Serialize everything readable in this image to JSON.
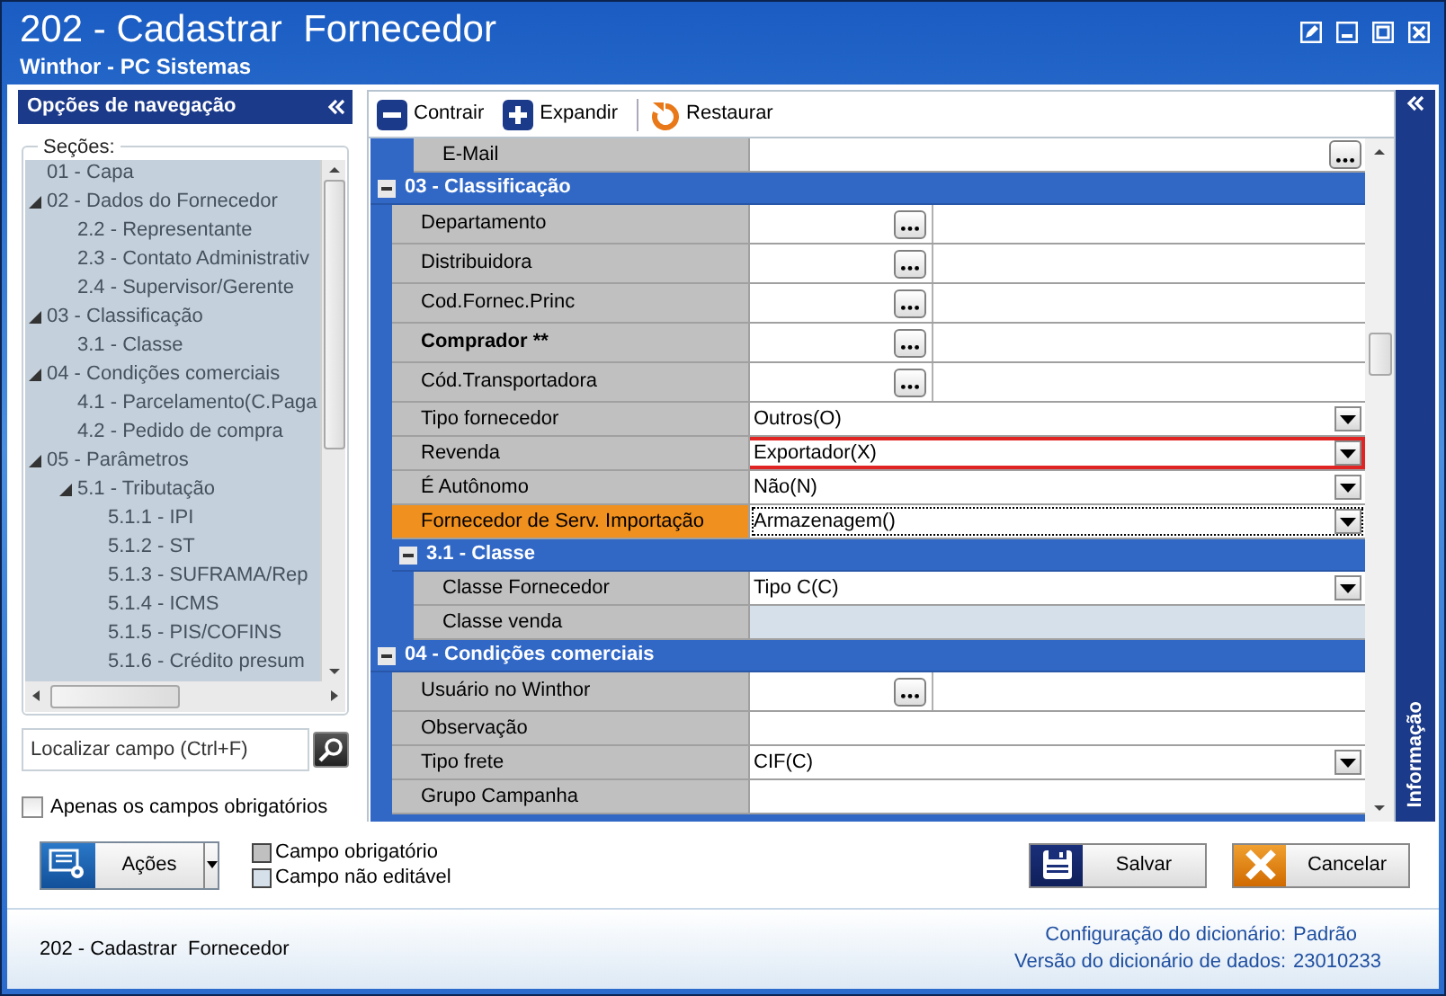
{
  "window": {
    "title": "202 - Cadastrar  Fornecedor",
    "subtitle": "Winthor - PC Sistemas"
  },
  "navigation": {
    "title": "Opções de navegação",
    "sections_label": "Seções:",
    "tree": [
      {
        "label": "01 - Capa"
      },
      {
        "label": "02 - Dados do Fornecedor",
        "expanded": true,
        "children": [
          {
            "label": "2.2 - Representante"
          },
          {
            "label": "2.3 - Contato Administrativ"
          },
          {
            "label": "2.4 - Supervisor/Gerente"
          }
        ]
      },
      {
        "label": "03 - Classificação",
        "expanded": true,
        "children": [
          {
            "label": "3.1 - Classe"
          }
        ]
      },
      {
        "label": "04 - Condições comerciais",
        "expanded": true,
        "children": [
          {
            "label": "4.1 - Parcelamento(C.Paga"
          },
          {
            "label": "4.2 - Pedido de compra"
          }
        ]
      },
      {
        "label": "05 - Parâmetros",
        "expanded": true,
        "children": [
          {
            "label": "5.1 - Tributação",
            "expanded": true,
            "children": [
              {
                "label": "5.1.1 - IPI"
              },
              {
                "label": "5.1.2 - ST"
              },
              {
                "label": "5.1.3 - SUFRAMA/Rep"
              },
              {
                "label": "5.1.4 - ICMS"
              },
              {
                "label": "5.1.5 - PIS/COFINS"
              },
              {
                "label": "5.1.6 - Crédito presum"
              }
            ]
          }
        ]
      }
    ],
    "search": {
      "placeholder": "Localizar campo (Ctrl+F)"
    },
    "required_only": {
      "label": "Apenas os campos obrigatórios",
      "checked": false
    }
  },
  "toolbar": [
    {
      "label": "Contrair",
      "kind": "collapse"
    },
    {
      "label": "Expandir",
      "kind": "expand"
    },
    {
      "label": "Restaurar",
      "kind": "restore"
    }
  ],
  "grid": {
    "sections": [
      {
        "kind": "section",
        "children": [
          {
            "kind": "section",
            "children": [
              {
                "kind": "ellipsis",
                "label": "E-Mail",
                "required": false,
                "selected": false,
                "highlighted": false,
                "disabled": false
              }
            ]
          }
        ]
      },
      {
        "kind": "section",
        "title": "03 - Classificação",
        "expanded": true,
        "children": [
          {
            "kind": "lookup",
            "label": "Departamento",
            "required": false,
            "selected": false,
            "highlighted": false,
            "disabled": false
          },
          {
            "kind": "lookup",
            "label": "Distribuidora",
            "required": false,
            "selected": false,
            "highlighted": false,
            "disabled": false
          },
          {
            "kind": "lookup",
            "label": "Cod.Fornec.Princ",
            "required": false,
            "selected": false,
            "highlighted": false,
            "disabled": false
          },
          {
            "kind": "lookup",
            "label": "Comprador **",
            "required": true,
            "selected": false,
            "highlighted": false,
            "disabled": false
          },
          {
            "kind": "lookup",
            "label": "Cód.Transportadora",
            "required": false,
            "selected": false,
            "highlighted": false,
            "disabled": false
          },
          {
            "kind": "combo",
            "label": "Tipo fornecedor",
            "value": "Outros(O)",
            "required": false,
            "selected": false,
            "highlighted": false,
            "disabled": false
          },
          {
            "kind": "combo",
            "label": "Revenda",
            "value": "Exportador(X)",
            "required": false,
            "selected": false,
            "highlighted": true,
            "disabled": false
          },
          {
            "kind": "combo",
            "label": "É Autônomo",
            "value": "Não(N)",
            "required": false,
            "selected": false,
            "highlighted": false,
            "disabled": false
          },
          {
            "kind": "combo",
            "label": "Fornecedor de Serv. Importação",
            "value": "Armazenagem()",
            "required": false,
            "selected": true,
            "highlighted": false,
            "disabled": false
          },
          {
            "kind": "section",
            "title": "3.1 - Classe",
            "expanded": true,
            "children": [
              {
                "kind": "combo",
                "label": "Classe Fornecedor",
                "value": "Tipo C(C)",
                "required": false,
                "selected": false,
                "highlighted": false,
                "disabled": false
              },
              {
                "kind": "text",
                "label": "Classe venda",
                "required": false,
                "selected": false,
                "highlighted": false,
                "disabled": true
              }
            ]
          }
        ]
      },
      {
        "kind": "section",
        "title": "04 - Condições comerciais",
        "expanded": true,
        "children": [
          {
            "kind": "lookup",
            "label": "Usuário no Winthor",
            "required": false,
            "selected": false,
            "highlighted": false,
            "disabled": false
          },
          {
            "kind": "text",
            "label": "Observação",
            "required": false,
            "selected": false,
            "highlighted": false,
            "disabled": false
          },
          {
            "kind": "combo",
            "label": "Tipo frete",
            "value": "CIF(C)",
            "required": false,
            "selected": false,
            "highlighted": false,
            "disabled": false
          },
          {
            "kind": "text",
            "label": "Grupo Campanha",
            "required": false,
            "selected": false,
            "highlighted": false,
            "disabled": false
          }
        ]
      }
    ]
  },
  "info_panel": {
    "title": "Informação"
  },
  "actions": {
    "label": "Ações"
  },
  "legend": [
    {
      "label": "Campo obrigatório",
      "color": "#c0c0c0"
    },
    {
      "label": "Campo não editável",
      "color": "#d6e0ea"
    }
  ],
  "buttons": [
    {
      "label": "Salvar",
      "kind": "save"
    },
    {
      "label": "Cancelar",
      "kind": "cancel"
    }
  ],
  "footer": {
    "screen": "202 - Cadastrar  Fornecedor",
    "info": [
      {
        "label": "Configuração do dicionário:",
        "value": "Padrão"
      },
      {
        "label": "Versão do dicionário de dados:",
        "value": "23010233"
      }
    ]
  }
}
